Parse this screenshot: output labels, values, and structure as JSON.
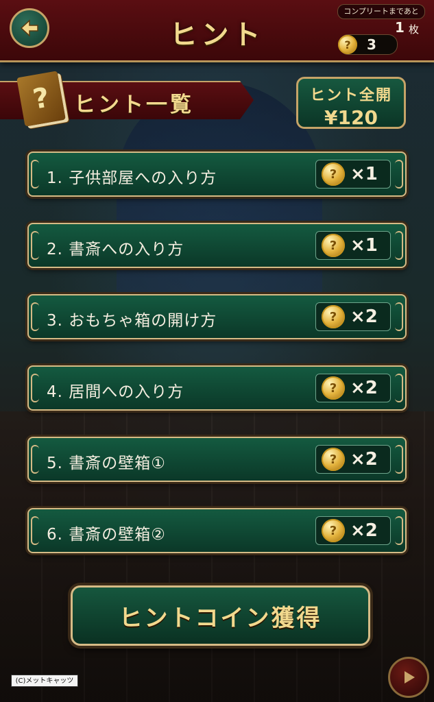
{
  "header": {
    "title": "ヒント",
    "complete_label": "コンプリートまであと",
    "complete_count": "1",
    "complete_unit": "枚",
    "coin_balance": "3"
  },
  "section": {
    "title": "ヒント一覧",
    "book_icon_glyph": "?"
  },
  "unlock_all": {
    "line1": "ヒント全開",
    "line2": "¥120"
  },
  "hints": [
    {
      "label": "1. 子供部屋への入り方",
      "cost": "×1"
    },
    {
      "label": "2. 書斎への入り方",
      "cost": "×1"
    },
    {
      "label": "3. おもちゃ箱の開け方",
      "cost": "×2"
    },
    {
      "label": "4. 居間への入り方",
      "cost": "×2"
    },
    {
      "label": "5. 書斎の壁箱①",
      "cost": "×2"
    },
    {
      "label": "6. 書斎の壁箱②",
      "cost": "×2"
    }
  ],
  "get_coins_label": "ヒントコイン獲得",
  "copyright": "(C)メットキャッツ",
  "coin_glyph": "?",
  "colors": {
    "header_red": "#4a0a0d",
    "panel_green": "#0f4a34",
    "gold_text": "#f2d98e",
    "frame_gold": "#d6bb86"
  }
}
